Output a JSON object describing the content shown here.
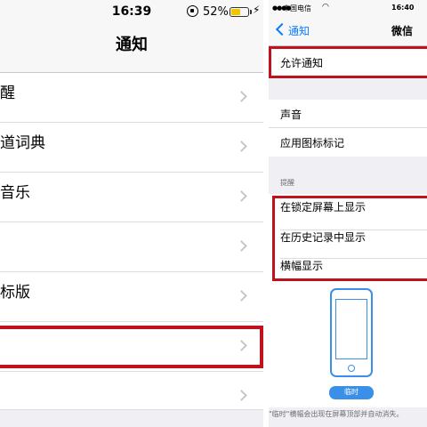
{
  "left": {
    "status": {
      "time": "16:39",
      "battery_pct": "52%",
      "battery_level": 0.52,
      "battery_color": "#f5c400"
    },
    "nav_title": "通知",
    "rows": [
      {
        "label": "醒"
      },
      {
        "label": "道词典"
      },
      {
        "label": "音乐"
      },
      {
        "label": ""
      },
      {
        "label": "标版"
      },
      {
        "label": ""
      },
      {
        "label": ""
      }
    ]
  },
  "right": {
    "status": {
      "carrier": "中国电信",
      "time": "16:40"
    },
    "nav": {
      "back_label": "通知",
      "title": "微信"
    },
    "allow_label": "允许通知",
    "sound_label": "声音",
    "badge_label": "应用图标标记",
    "section_header": "提醒",
    "alert_rows": [
      {
        "label": "在锁定屏幕上显示"
      },
      {
        "label": "在历史记录中显示"
      },
      {
        "label": "横幅显示"
      }
    ],
    "temp_button": "临时",
    "footer_text": "\"临时\"横幅会出现在屏幕顶部并自动消失。"
  },
  "colors": {
    "accent": "#0a7aff",
    "highlight": "#c0121c",
    "illustration": "#3a8fe8"
  }
}
